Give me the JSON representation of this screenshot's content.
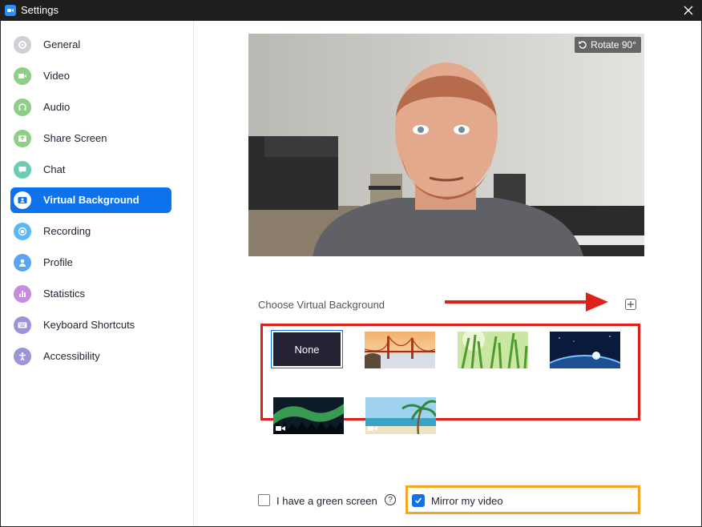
{
  "window": {
    "title": "Settings"
  },
  "sidebar": {
    "items": [
      {
        "label": "General",
        "icon": "gear-icon",
        "color": "#cfcfd4",
        "active": false
      },
      {
        "label": "Video",
        "icon": "video-camera-icon",
        "color": "#8dcf85",
        "active": false
      },
      {
        "label": "Audio",
        "icon": "headphones-icon",
        "color": "#8dcf85",
        "active": false
      },
      {
        "label": "Share Screen",
        "icon": "share-screen-icon",
        "color": "#8dcf85",
        "active": false
      },
      {
        "label": "Chat",
        "icon": "chat-bubble-icon",
        "color": "#6ccbb3",
        "active": false
      },
      {
        "label": "Virtual Background",
        "icon": "person-card-icon",
        "color": "#0e72ed",
        "active": true
      },
      {
        "label": "Recording",
        "icon": "record-icon",
        "color": "#59b7f3",
        "active": false
      },
      {
        "label": "Profile",
        "icon": "person-icon",
        "color": "#59a4f3",
        "active": false
      },
      {
        "label": "Statistics",
        "icon": "bar-chart-icon",
        "color": "#c68ce0",
        "active": false
      },
      {
        "label": "Keyboard Shortcuts",
        "icon": "keyboard-icon",
        "color": "#9a95d8",
        "active": false
      },
      {
        "label": "Accessibility",
        "icon": "accessibility-icon",
        "color": "#9a95d8",
        "active": false
      }
    ]
  },
  "preview": {
    "rotate_label": "Rotate 90°"
  },
  "virtual_background": {
    "section_label": "Choose Virtual Background",
    "none_label": "None",
    "thumbnails": [
      {
        "name": "golden-gate-bridge",
        "video": false
      },
      {
        "name": "green-grass",
        "video": false
      },
      {
        "name": "earth-from-space",
        "video": false
      },
      {
        "name": "northern-lights",
        "video": true
      },
      {
        "name": "beach-palm",
        "video": true
      }
    ]
  },
  "options": {
    "green_screen_label": "I have a green screen",
    "green_screen_checked": false,
    "mirror_label": "Mirror my video",
    "mirror_checked": true
  },
  "colors": {
    "accent": "#0e72ed",
    "highlight_red": "#e0201b",
    "highlight_orange": "#f5a623"
  }
}
